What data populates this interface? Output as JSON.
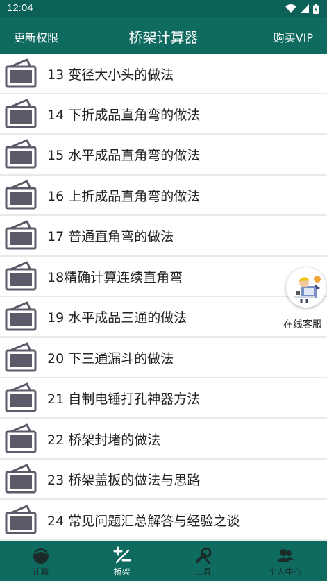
{
  "status": {
    "time": "12:04"
  },
  "header": {
    "left_label": "更新权限",
    "title": "桥架计算器",
    "right_label": "购买VIP"
  },
  "list": {
    "items": [
      "13 变径大小头的做法",
      "14 下折成品直角弯的做法",
      "15 水平成品直角弯的做法",
      "16 上折成品直角弯的做法",
      "17 普通直角弯的做法",
      " 18精确计算连续直角弯",
      "19 水平成品三通的做法",
      "20 下三通漏斗的做法",
      "21 自制电锤打孔神器方法",
      "22 桥架封堵的做法",
      "23 桥架盖板的做法与思路",
      "24 常见问题汇总解答与经验之谈"
    ]
  },
  "service": {
    "label": "在线客服"
  },
  "tabs": [
    {
      "label": "计算",
      "icon": "calc-icon",
      "active": false
    },
    {
      "label": "桥架",
      "icon": "tray-icon",
      "active": true
    },
    {
      "label": "工具",
      "icon": "tools-icon",
      "active": false
    },
    {
      "label": "个人中心",
      "icon": "profile-icon",
      "active": false
    }
  ],
  "colors": {
    "primary": "#0f6b60",
    "status_bar": "#0b6157",
    "icon_fill": "#5a5a68",
    "active_tab": "#ffffff",
    "inactive_tab": "#1b2b28"
  }
}
